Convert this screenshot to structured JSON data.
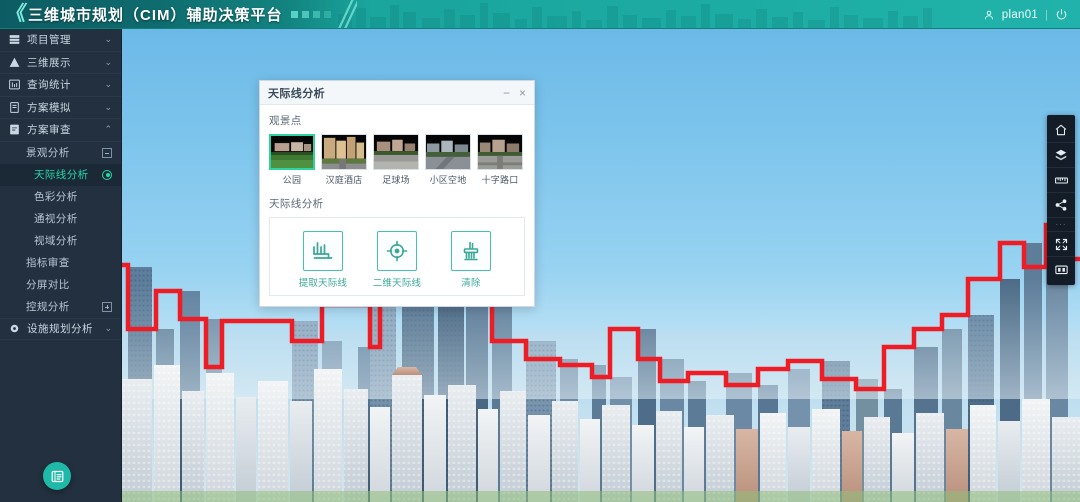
{
  "app": {
    "title": "三维城市规划（CIM）辅助决策平台",
    "accent": "#1aa79f",
    "sidebar_bg": "#22303f",
    "active_color": "#25d6a8",
    "skyline_line_color": "#ee1c25"
  },
  "topbar": {
    "user_icon": "user-icon",
    "username": "plan01",
    "separator": "|",
    "power_icon": "power-icon"
  },
  "sidebar": {
    "groups": [
      {
        "label": "项目管理",
        "icon": "database-icon",
        "chevron": "⌄"
      },
      {
        "label": "三维展示",
        "icon": "pyramid-icon",
        "chevron": "⌄"
      },
      {
        "label": "查询统计",
        "icon": "bar-chart-icon",
        "chevron": "⌄"
      },
      {
        "label": "方案模拟",
        "icon": "document-icon",
        "chevron": "⌄"
      },
      {
        "label": "方案审查",
        "icon": "document-check-icon",
        "chevron": "⌃"
      }
    ],
    "sub_items": [
      {
        "label": "景观分析",
        "control": "collapse-box",
        "active": false,
        "indent": 1
      },
      {
        "label": "天际线分析",
        "control": "radio-dot",
        "active": true,
        "indent": 2
      },
      {
        "label": "色彩分析",
        "control": "none",
        "active": false,
        "indent": 2
      },
      {
        "label": "通视分析",
        "control": "none",
        "active": false,
        "indent": 2
      },
      {
        "label": "视域分析",
        "control": "none",
        "active": false,
        "indent": 2
      },
      {
        "label": "指标审查",
        "control": "none",
        "active": false,
        "indent": 1
      },
      {
        "label": "分屏对比",
        "control": "none",
        "active": false,
        "indent": 1
      },
      {
        "label": "控规分析",
        "control": "expand-box",
        "active": false,
        "indent": 1
      }
    ],
    "last_group": {
      "label": "设施规划分析",
      "icon": "facility-icon",
      "chevron": "⌄"
    },
    "fab_icon": "list-panel-icon"
  },
  "dialog": {
    "title": "天际线分析",
    "minimize_label": "−",
    "close_label": "×",
    "viewpoint_section_label": "观景点",
    "viewpoints": [
      {
        "label": "公园",
        "selected": true
      },
      {
        "label": "汉庭酒店",
        "selected": false
      },
      {
        "label": "足球场",
        "selected": false
      },
      {
        "label": "小区空地",
        "selected": false
      },
      {
        "label": "十字路口",
        "selected": false
      }
    ],
    "analysis_section_label": "天际线分析",
    "actions": [
      {
        "label": "提取天际线",
        "icon": "skyline-wave-icon"
      },
      {
        "label": "二维天际线",
        "icon": "crosshair-target-icon"
      },
      {
        "label": "清除",
        "icon": "brush-clear-icon"
      }
    ]
  },
  "right_toolbar": {
    "items": [
      {
        "icon": "home-icon"
      },
      {
        "icon": "layers-cube-icon"
      },
      {
        "icon": "measure-icon"
      },
      {
        "icon": "share-icon"
      },
      {
        "icon": "more-dots-icon"
      },
      {
        "icon": "fullscreen-icon"
      },
      {
        "icon": "screenshot-icon"
      }
    ],
    "more_dots_label": "···"
  },
  "viewport": {
    "scene_name": "city-skyline-3d-view",
    "skyline_overlay_name": "extracted-skyline-polyline"
  }
}
